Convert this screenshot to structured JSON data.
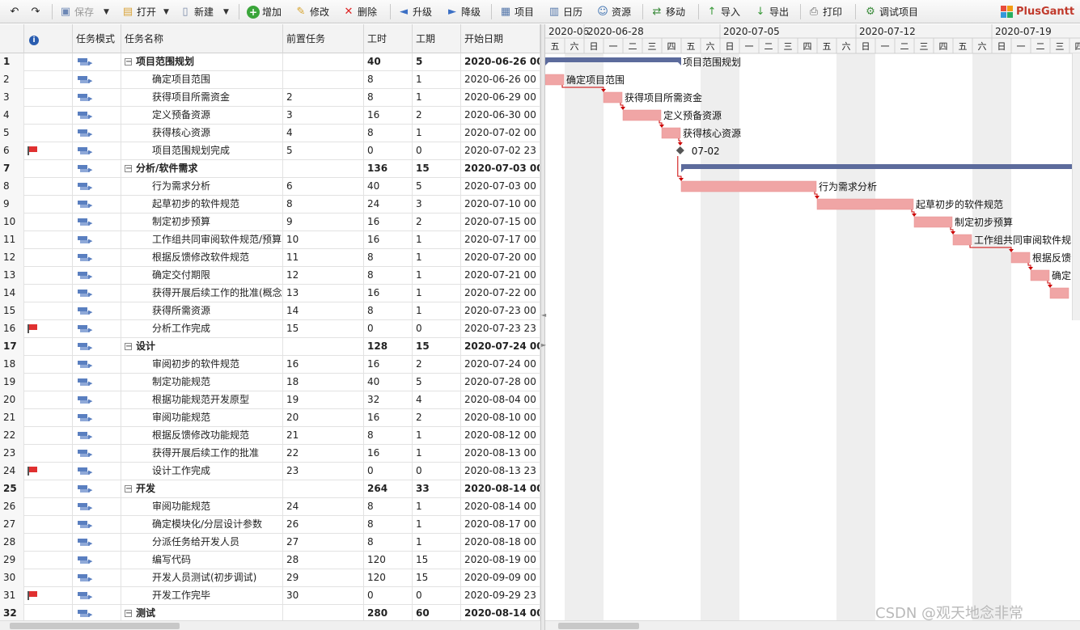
{
  "toolbar": {
    "undo_icon": "undo-icon",
    "redo_icon": "redo-icon",
    "save": "保存",
    "open": "打开",
    "new": "新建",
    "add": "增加",
    "edit": "修改",
    "delete": "删除",
    "upgrade": "升级",
    "downgrade": "降级",
    "project": "项目",
    "calendar": "日历",
    "resource": "资源",
    "move": "移动",
    "import": "导入",
    "export": "导出",
    "print": "打印",
    "debug": "调试项目",
    "logo": "PlusGantt"
  },
  "grid": {
    "columns": {
      "info": "i",
      "mode": "任务模式",
      "name": "任务名称",
      "pred": "前置任务",
      "work": "工时",
      "duration": "工期",
      "start": "开始日期"
    },
    "rows": [
      {
        "id": "1",
        "name": "项目范围规划",
        "pred": "",
        "work": "40",
        "dur": "5",
        "start": "2020-06-26 00",
        "summary": true,
        "level": 0,
        "flag": false
      },
      {
        "id": "2",
        "name": "确定项目范围",
        "pred": "",
        "work": "8",
        "dur": "1",
        "start": "2020-06-26 00",
        "summary": false,
        "level": 1,
        "flag": false
      },
      {
        "id": "3",
        "name": "获得项目所需资金",
        "pred": "2",
        "work": "8",
        "dur": "1",
        "start": "2020-06-29 00",
        "summary": false,
        "level": 1,
        "flag": false
      },
      {
        "id": "4",
        "name": "定义预备资源",
        "pred": "3",
        "work": "16",
        "dur": "2",
        "start": "2020-06-30 00",
        "summary": false,
        "level": 1,
        "flag": false
      },
      {
        "id": "5",
        "name": "获得核心资源",
        "pred": "4",
        "work": "8",
        "dur": "1",
        "start": "2020-07-02 00",
        "summary": false,
        "level": 1,
        "flag": false
      },
      {
        "id": "6",
        "name": "项目范围规划完成",
        "pred": "5",
        "work": "0",
        "dur": "0",
        "start": "2020-07-02 23",
        "summary": false,
        "level": 1,
        "flag": true
      },
      {
        "id": "7",
        "name": "分析/软件需求",
        "pred": "",
        "work": "136",
        "dur": "15",
        "start": "2020-07-03 00",
        "summary": true,
        "level": 0,
        "flag": false
      },
      {
        "id": "8",
        "name": "行为需求分析",
        "pred": "6",
        "work": "40",
        "dur": "5",
        "start": "2020-07-03 00",
        "summary": false,
        "level": 1,
        "flag": false
      },
      {
        "id": "9",
        "name": "起草初步的软件规范",
        "pred": "8",
        "work": "24",
        "dur": "3",
        "start": "2020-07-10 00",
        "summary": false,
        "level": 1,
        "flag": false
      },
      {
        "id": "10",
        "name": "制定初步预算",
        "pred": "9",
        "work": "16",
        "dur": "2",
        "start": "2020-07-15 00",
        "summary": false,
        "level": 1,
        "flag": false
      },
      {
        "id": "11",
        "name": "工作组共同审阅软件规范/预算",
        "pred": "10",
        "work": "16",
        "dur": "1",
        "start": "2020-07-17 00",
        "summary": false,
        "level": 1,
        "flag": false
      },
      {
        "id": "12",
        "name": "根据反馈修改软件规范",
        "pred": "11",
        "work": "8",
        "dur": "1",
        "start": "2020-07-20 00",
        "summary": false,
        "level": 1,
        "flag": false
      },
      {
        "id": "13",
        "name": "确定交付期限",
        "pred": "12",
        "work": "8",
        "dur": "1",
        "start": "2020-07-21 00",
        "summary": false,
        "level": 1,
        "flag": false
      },
      {
        "id": "14",
        "name": "获得开展后续工作的批准(概念",
        "pred": "13",
        "work": "16",
        "dur": "1",
        "start": "2020-07-22 00",
        "summary": false,
        "level": 1,
        "flag": false
      },
      {
        "id": "15",
        "name": "获得所需资源",
        "pred": "14",
        "work": "8",
        "dur": "1",
        "start": "2020-07-23 00",
        "summary": false,
        "level": 1,
        "flag": false
      },
      {
        "id": "16",
        "name": "分析工作完成",
        "pred": "15",
        "work": "0",
        "dur": "0",
        "start": "2020-07-23 23",
        "summary": false,
        "level": 1,
        "flag": true
      },
      {
        "id": "17",
        "name": "设计",
        "pred": "",
        "work": "128",
        "dur": "15",
        "start": "2020-07-24 00",
        "summary": true,
        "level": 0,
        "flag": false
      },
      {
        "id": "18",
        "name": "审阅初步的软件规范",
        "pred": "16",
        "work": "16",
        "dur": "2",
        "start": "2020-07-24 00",
        "summary": false,
        "level": 1,
        "flag": false
      },
      {
        "id": "19",
        "name": "制定功能规范",
        "pred": "18",
        "work": "40",
        "dur": "5",
        "start": "2020-07-28 00",
        "summary": false,
        "level": 1,
        "flag": false
      },
      {
        "id": "20",
        "name": "根据功能规范开发原型",
        "pred": "19",
        "work": "32",
        "dur": "4",
        "start": "2020-08-04 00",
        "summary": false,
        "level": 1,
        "flag": false
      },
      {
        "id": "21",
        "name": "审阅功能规范",
        "pred": "20",
        "work": "16",
        "dur": "2",
        "start": "2020-08-10 00",
        "summary": false,
        "level": 1,
        "flag": false
      },
      {
        "id": "22",
        "name": "根据反馈修改功能规范",
        "pred": "21",
        "work": "8",
        "dur": "1",
        "start": "2020-08-12 00",
        "summary": false,
        "level": 1,
        "flag": false
      },
      {
        "id": "23",
        "name": "获得开展后续工作的批准",
        "pred": "22",
        "work": "16",
        "dur": "1",
        "start": "2020-08-13 00",
        "summary": false,
        "level": 1,
        "flag": false
      },
      {
        "id": "24",
        "name": "设计工作完成",
        "pred": "23",
        "work": "0",
        "dur": "0",
        "start": "2020-08-13 23",
        "summary": false,
        "level": 1,
        "flag": true
      },
      {
        "id": "25",
        "name": "开发",
        "pred": "",
        "work": "264",
        "dur": "33",
        "start": "2020-08-14 00",
        "summary": true,
        "level": 0,
        "flag": false
      },
      {
        "id": "26",
        "name": "审阅功能规范",
        "pred": "24",
        "work": "8",
        "dur": "1",
        "start": "2020-08-14 00",
        "summary": false,
        "level": 1,
        "flag": false
      },
      {
        "id": "27",
        "name": "确定模块化/分层设计参数",
        "pred": "26",
        "work": "8",
        "dur": "1",
        "start": "2020-08-17 00",
        "summary": false,
        "level": 1,
        "flag": false
      },
      {
        "id": "28",
        "name": "分派任务给开发人员",
        "pred": "27",
        "work": "8",
        "dur": "1",
        "start": "2020-08-18 00",
        "summary": false,
        "level": 1,
        "flag": false
      },
      {
        "id": "29",
        "name": "编写代码",
        "pred": "28",
        "work": "120",
        "dur": "15",
        "start": "2020-08-19 00",
        "summary": false,
        "level": 1,
        "flag": false
      },
      {
        "id": "30",
        "name": "开发人员测试(初步调试)",
        "pred": "29",
        "work": "120",
        "dur": "15",
        "start": "2020-09-09 00",
        "summary": false,
        "level": 1,
        "flag": false
      },
      {
        "id": "31",
        "name": "开发工作完毕",
        "pred": "30",
        "work": "0",
        "dur": "0",
        "start": "2020-09-29 23",
        "summary": false,
        "level": 1,
        "flag": true
      },
      {
        "id": "32",
        "name": "测试",
        "pred": "",
        "work": "280",
        "dur": "60",
        "start": "2020-08-14 00",
        "summary": true,
        "level": 0,
        "flag": false
      }
    ]
  },
  "gantt": {
    "weeks": [
      "2020-06",
      "2020-06-28",
      "2020-07-05",
      "2020-07-12",
      "2020-07-19"
    ],
    "days": [
      "五",
      "六",
      "日",
      "一",
      "二",
      "三",
      "四",
      "五",
      "六",
      "日",
      "一",
      "二",
      "三",
      "四",
      "五",
      "六",
      "日",
      "一",
      "二",
      "三",
      "四",
      "五",
      "六",
      "日",
      "一",
      "二",
      "三",
      "四"
    ],
    "milestone_label": "07-02",
    "bars": [
      {
        "row": 0,
        "type": "summary",
        "start": 0,
        "len": 7,
        "label": "项目范围规划"
      },
      {
        "row": 1,
        "type": "task",
        "start": 0,
        "len": 1,
        "label": "确定项目范围"
      },
      {
        "row": 2,
        "type": "task",
        "start": 3,
        "len": 1,
        "label": "获得项目所需资金"
      },
      {
        "row": 3,
        "type": "task",
        "start": 4,
        "len": 2,
        "label": "定义预备资源"
      },
      {
        "row": 4,
        "type": "task",
        "start": 6,
        "len": 1,
        "label": "获得核心资源"
      },
      {
        "row": 5,
        "type": "milestone",
        "start": 6.95,
        "len": 0,
        "label": "07-02"
      },
      {
        "row": 6,
        "type": "summary",
        "start": 7,
        "len": 21,
        "label": ""
      },
      {
        "row": 7,
        "type": "task",
        "start": 7,
        "len": 7,
        "label": "行为需求分析"
      },
      {
        "row": 8,
        "type": "task",
        "start": 14,
        "len": 5,
        "label": "起草初步的软件规范"
      },
      {
        "row": 9,
        "type": "task",
        "start": 19,
        "len": 2,
        "label": "制定初步预算"
      },
      {
        "row": 10,
        "type": "task",
        "start": 21,
        "len": 1,
        "label": "工作组共同审阅软件规"
      },
      {
        "row": 11,
        "type": "task",
        "start": 24,
        "len": 1,
        "label": "根据反馈"
      },
      {
        "row": 12,
        "type": "task",
        "start": 25,
        "len": 1,
        "label": "确定"
      },
      {
        "row": 13,
        "type": "task",
        "start": 26,
        "len": 1,
        "label": ""
      }
    ]
  },
  "watermark": "CSDN @观天地念非常"
}
